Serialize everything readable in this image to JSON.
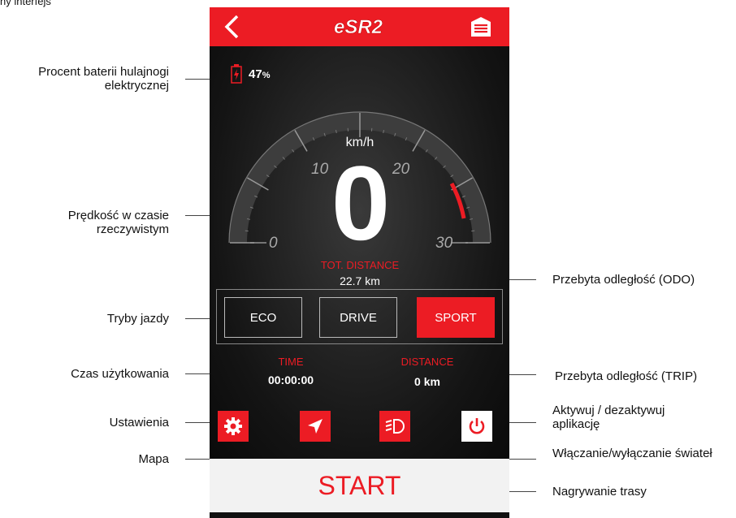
{
  "top_fragment": "ny interfejs",
  "annotations": {
    "battery": "Procent baterii hulajnogi elektrycznej",
    "speed": "Prędkość w czasie rzeczywistym",
    "modes": "Tryby jazdy",
    "time": "Czas użytkowania",
    "settings": "Ustawienia",
    "map": "Mapa",
    "odo": "Przebyta odległość (ODO)",
    "trip": "Przebyta odległość (TRIP)",
    "app_toggle": "Aktywuj / dezaktywuj aplikację",
    "lights": "Włączanie/wyłączanie świateł",
    "record": "Nagrywanie trasy"
  },
  "app": {
    "logo": "eSR2",
    "battery_percent": "47",
    "battery_unit": "%",
    "speed": "0",
    "speed_unit": "km/h",
    "gauge_labels": [
      "0",
      "10",
      "20",
      "30"
    ],
    "total_distance_label": "TOT. DISTANCE",
    "total_distance_value": "22.7 km",
    "modes": [
      {
        "label": "ECO",
        "active": false
      },
      {
        "label": "DRIVE",
        "active": false
      },
      {
        "label": "SPORT",
        "active": true
      }
    ],
    "time_label": "TIME",
    "time_value": "00:00:00",
    "distance_label": "DISTANCE",
    "distance_value": "0 km",
    "start_label": "START",
    "colors": {
      "accent": "#ec1c24",
      "background": "#0d0d0d"
    }
  }
}
